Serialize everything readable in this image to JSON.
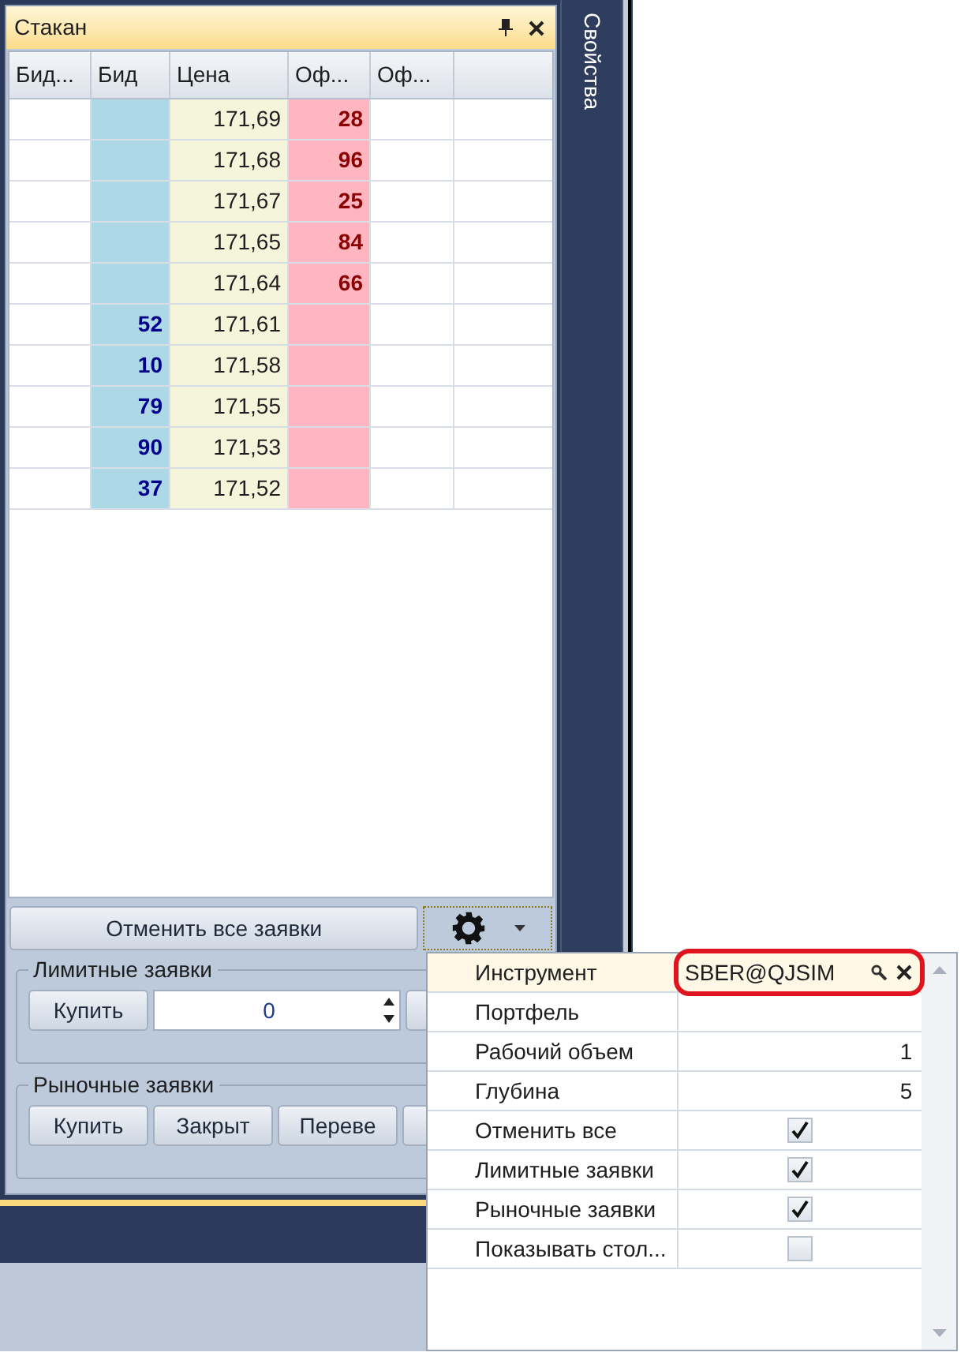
{
  "panel": {
    "title": "Стакан"
  },
  "order_book": {
    "columns": [
      "Бид...",
      "Бид",
      "Цена",
      "Оф...",
      "Оф..."
    ],
    "rows": [
      {
        "price": "171,69",
        "offer": "28"
      },
      {
        "price": "171,68",
        "offer": "96"
      },
      {
        "price": "171,67",
        "offer": "25"
      },
      {
        "price": "171,65",
        "offer": "84"
      },
      {
        "price": "171,64",
        "offer": "66"
      },
      {
        "bid": "52",
        "price": "171,61"
      },
      {
        "bid": "10",
        "price": "171,58"
      },
      {
        "bid": "79",
        "price": "171,55"
      },
      {
        "bid": "90",
        "price": "171,53"
      },
      {
        "bid": "37",
        "price": "171,52"
      }
    ]
  },
  "cancel_all_button": "Отменить все заявки",
  "limit_orders": {
    "title": "Лимитные заявки",
    "buy_button": "Купить",
    "quantity": "0"
  },
  "market_orders": {
    "title": "Рыночные заявки",
    "buttons": [
      "Купить",
      "Закрыт",
      "Переве"
    ]
  },
  "side_tab": "Свойства",
  "settings_popup": {
    "rows": [
      {
        "label": "Инструмент",
        "kind": "instrument",
        "value": "SBER@QJSIM",
        "selected": true
      },
      {
        "label": "Портфель",
        "kind": "text",
        "selected": false
      },
      {
        "label": "Рабочий объем",
        "kind": "text",
        "value": "1",
        "selected": false
      },
      {
        "label": "Глубина",
        "kind": "text",
        "value": "5",
        "selected": false
      },
      {
        "label": "Отменить все",
        "kind": "checkbox",
        "checked": true,
        "selected": false
      },
      {
        "label": "Лимитные заявки",
        "kind": "checkbox",
        "checked": true,
        "selected": false
      },
      {
        "label": "Рыночные заявки",
        "kind": "checkbox",
        "checked": true,
        "selected": false
      },
      {
        "label": "Показывать стол...",
        "kind": "checkbox",
        "checked": false,
        "selected": false
      }
    ]
  }
}
